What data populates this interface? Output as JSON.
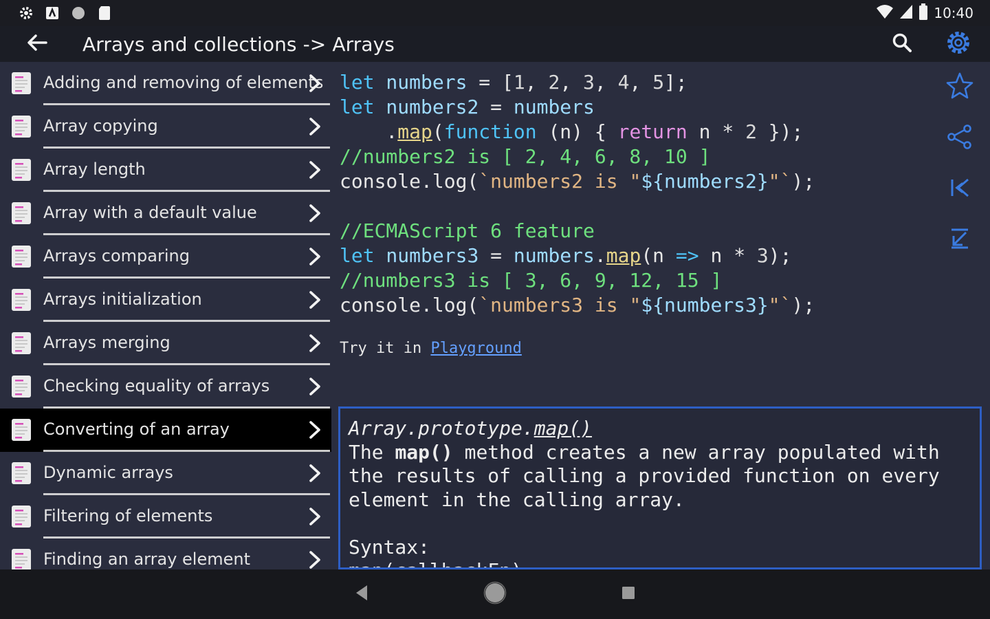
{
  "status_bar": {
    "time": "10:40",
    "left_icons": [
      "settings-icon",
      "app-notification-icon",
      "circle-status-icon",
      "sd-card-icon"
    ],
    "right_icons": [
      "wifi-icon",
      "signal-icon",
      "battery-icon"
    ]
  },
  "app_bar": {
    "title": "Arrays and collections -> Arrays",
    "actions": [
      "search-icon",
      "gear-icon"
    ],
    "accent": "#3a7be0"
  },
  "sidebar": {
    "items": [
      {
        "label": "Adding and removing of elements",
        "selected": false
      },
      {
        "label": "Array copying",
        "selected": false
      },
      {
        "label": "Array length",
        "selected": false
      },
      {
        "label": "Array with a default value",
        "selected": false
      },
      {
        "label": "Arrays comparing",
        "selected": false
      },
      {
        "label": "Arrays initialization",
        "selected": false
      },
      {
        "label": "Arrays merging",
        "selected": false
      },
      {
        "label": "Checking equality of arrays",
        "selected": false
      },
      {
        "label": "Converting of an array",
        "selected": true
      },
      {
        "label": "Dynamic arrays",
        "selected": false
      },
      {
        "label": "Filtering of elements",
        "selected": false
      },
      {
        "label": "Finding an array element",
        "selected": false
      }
    ]
  },
  "code": {
    "lines": [
      [
        {
          "t": "let",
          "c": "kw"
        },
        {
          "t": " numbers ",
          "c": "vr"
        },
        {
          "t": "= [",
          "c": "pl"
        },
        {
          "t": "1",
          "c": "num"
        },
        {
          "t": ", ",
          "c": "pl"
        },
        {
          "t": "2",
          "c": "num"
        },
        {
          "t": ", ",
          "c": "pl"
        },
        {
          "t": "3",
          "c": "num"
        },
        {
          "t": ", ",
          "c": "pl"
        },
        {
          "t": "4",
          "c": "num"
        },
        {
          "t": ", ",
          "c": "pl"
        },
        {
          "t": "5",
          "c": "num"
        },
        {
          "t": "];",
          "c": "pl"
        }
      ],
      [
        {
          "t": "let",
          "c": "kw"
        },
        {
          "t": " numbers2 ",
          "c": "vr"
        },
        {
          "t": "= ",
          "c": "pl"
        },
        {
          "t": "numbers",
          "c": "vr"
        }
      ],
      [
        {
          "t": "    .",
          "c": "pl"
        },
        {
          "t": "map",
          "c": "fn"
        },
        {
          "t": "(",
          "c": "pl"
        },
        {
          "t": "function",
          "c": "kw"
        },
        {
          "t": " (n) { ",
          "c": "pl"
        },
        {
          "t": "return",
          "c": "rt"
        },
        {
          "t": " n * ",
          "c": "pl"
        },
        {
          "t": "2",
          "c": "num"
        },
        {
          "t": " });",
          "c": "pl"
        }
      ],
      [
        {
          "t": "//numbers2 is [ 2, 4, 6, 8, 10 ]",
          "c": "cm"
        }
      ],
      [
        {
          "t": "console.log(",
          "c": "pl"
        },
        {
          "t": "`numbers2 is \"",
          "c": "str"
        },
        {
          "t": "${numbers2}",
          "c": "vr"
        },
        {
          "t": "\"`",
          "c": "str"
        },
        {
          "t": ");",
          "c": "pl"
        }
      ],
      [],
      [
        {
          "t": "//ECMAScript 6 feature",
          "c": "cm"
        }
      ],
      [
        {
          "t": "let",
          "c": "kw"
        },
        {
          "t": " numbers3 ",
          "c": "vr"
        },
        {
          "t": "= ",
          "c": "pl"
        },
        {
          "t": "numbers",
          "c": "vr"
        },
        {
          "t": ".",
          "c": "pl"
        },
        {
          "t": "map",
          "c": "fn"
        },
        {
          "t": "(n ",
          "c": "pl"
        },
        {
          "t": "=>",
          "c": "kw"
        },
        {
          "t": " n * ",
          "c": "pl"
        },
        {
          "t": "3",
          "c": "num"
        },
        {
          "t": ");",
          "c": "pl"
        }
      ],
      [
        {
          "t": "//numbers3 is [ 3, 6, 9, 12, 15 ]",
          "c": "cm"
        }
      ],
      [
        {
          "t": "console.log(",
          "c": "pl"
        },
        {
          "t": "`numbers3 is \"",
          "c": "str"
        },
        {
          "t": "${numbers3}",
          "c": "vr"
        },
        {
          "t": "\"`",
          "c": "str"
        },
        {
          "t": ");",
          "c": "pl"
        }
      ]
    ]
  },
  "try_it": {
    "prefix": "Try it in ",
    "link": "Playground"
  },
  "rail_actions": [
    "star-icon",
    "share-icon",
    "first-page-icon",
    "collapse-icon"
  ],
  "doc": {
    "title_prefix": "Array.prototype.",
    "title_fn": "map()",
    "line1_a": "The ",
    "line1_b": "map()",
    "line1_c": " method creates a new array populated with",
    "line2": "the results of calling a provided function on every",
    "line3": "element in the calling array.",
    "syntax_label": "Syntax:",
    "syntax_line": "map(callbackFn)"
  },
  "nav_bar": [
    "back-triangle-icon",
    "home-circle-icon",
    "recents-square-icon"
  ]
}
